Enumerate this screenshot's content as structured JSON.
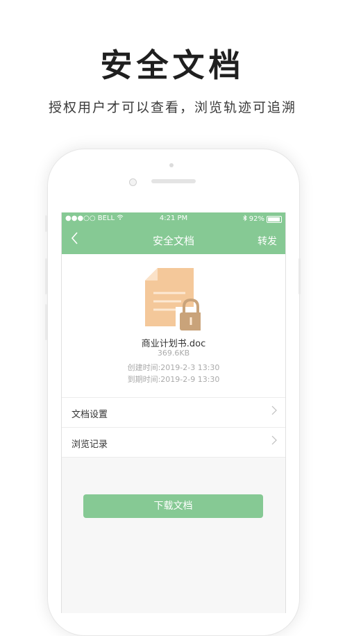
{
  "hero": {
    "title": "安全文档",
    "subtitle": "授权用户才可以查看，浏览轨迹可追溯"
  },
  "status_bar": {
    "carrier": "●●●○○ BELL",
    "time": "4:21 PM",
    "battery": "92%",
    "icons": [
      "wifi-icon",
      "bluetooth-icon",
      "battery-icon"
    ]
  },
  "navbar": {
    "back_icon": "chevron-left-icon",
    "title": "安全文档",
    "forward_label": "转发"
  },
  "document": {
    "icon": "locked-document-icon",
    "name": "商业计划书.doc",
    "size": "369.6KB",
    "created": "创建时间:2019-2-3 13:30",
    "expires": "到期时间:2019-2-9 13:30"
  },
  "menu": [
    {
      "label": "文档设置",
      "icon": "chevron-right-icon"
    },
    {
      "label": "浏览记录",
      "icon": "chevron-right-icon"
    }
  ],
  "download_label": "下载文档",
  "colors": {
    "accent": "#86c994",
    "doc_fill": "#f4c89a",
    "lock": "#c9a37a"
  }
}
